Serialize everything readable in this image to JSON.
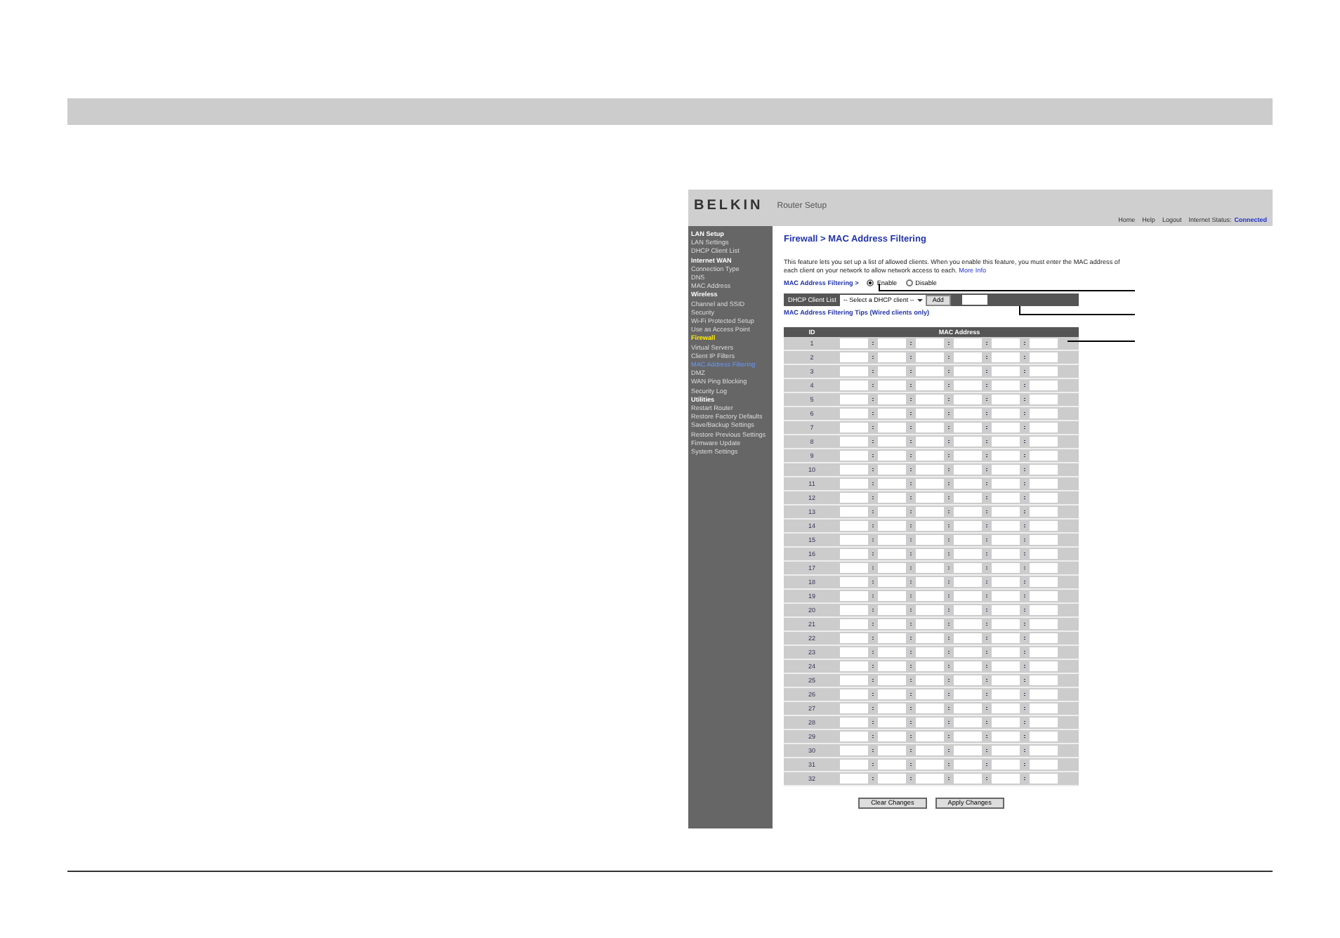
{
  "router": {
    "logo": "BELKIN",
    "title": "Router Setup",
    "nav": [
      "Home",
      "Help",
      "Logout"
    ],
    "status_label": "Internet Status:",
    "status_value": "Connected"
  },
  "sidebar": {
    "items": [
      {
        "kind": "heading",
        "label": "LAN Setup",
        "selected": false
      },
      {
        "kind": "link",
        "label": "LAN Settings",
        "selected": false
      },
      {
        "kind": "link",
        "label": "DHCP Client List",
        "selected": false
      },
      {
        "kind": "heading",
        "label": "Internet WAN",
        "selected": false
      },
      {
        "kind": "link",
        "label": "Connection Type",
        "selected": false
      },
      {
        "kind": "link",
        "label": "DNS",
        "selected": false
      },
      {
        "kind": "link",
        "label": "MAC Address",
        "selected": false
      },
      {
        "kind": "heading",
        "label": "Wireless",
        "selected": false
      },
      {
        "kind": "link",
        "label": "Channel and SSID",
        "selected": false
      },
      {
        "kind": "link",
        "label": "Security",
        "selected": false
      },
      {
        "kind": "link",
        "label": "Wi-Fi Protected Setup",
        "selected": false
      },
      {
        "kind": "link",
        "label": "Use as Access Point",
        "selected": false
      },
      {
        "kind": "heading",
        "label": "Firewall",
        "selected": true
      },
      {
        "kind": "link",
        "label": "Virtual Servers",
        "selected": false
      },
      {
        "kind": "link",
        "label": "Client IP Filters",
        "selected": false
      },
      {
        "kind": "link",
        "label": "MAC Address Filtering",
        "selected": true
      },
      {
        "kind": "link",
        "label": "DMZ",
        "selected": false
      },
      {
        "kind": "link",
        "label": "WAN Ping Blocking",
        "selected": false
      },
      {
        "kind": "link",
        "label": "Security Log",
        "selected": false
      },
      {
        "kind": "heading",
        "label": "Utilities",
        "selected": false
      },
      {
        "kind": "link",
        "label": "Restart Router",
        "selected": false
      },
      {
        "kind": "link",
        "label": "Restore Factory Defaults",
        "selected": false
      },
      {
        "kind": "link",
        "label": "Save/Backup Settings",
        "selected": false
      },
      {
        "kind": "link",
        "label": "Restore Previous Settings",
        "selected": false
      },
      {
        "kind": "link",
        "label": "Firmware Update",
        "selected": false
      },
      {
        "kind": "link",
        "label": "System Settings",
        "selected": false
      }
    ]
  },
  "content": {
    "breadcrumb": "Firewall > MAC Address Filtering",
    "description": "This feature lets you set up a list of allowed clients. When you enable this feature, you must enter the MAC address of each client on your network to allow network access to each.",
    "more_info": "More Info",
    "filter": {
      "label": "MAC Address Filtering >",
      "options": [
        {
          "label": "Enable",
          "selected": true
        },
        {
          "label": "Disable",
          "selected": false
        }
      ]
    },
    "dhcp": {
      "label": "DHCP Client List",
      "select": "-- Select a DHCP client --",
      "button": "Add"
    },
    "tips_link": "MAC Address Filtering Tips (Wired clients only)",
    "table": {
      "columns": [
        "ID",
        "MAC Address"
      ],
      "rows": [
        "1",
        "2",
        "3",
        "4",
        "5",
        "6",
        "7",
        "8",
        "9",
        "10",
        "11",
        "12",
        "13",
        "14",
        "15",
        "16",
        "17",
        "18",
        "19",
        "20",
        "21",
        "22",
        "23",
        "24",
        "25",
        "26",
        "27",
        "28",
        "29",
        "30",
        "31",
        "32"
      ]
    },
    "buttons": [
      "Clear Changes",
      "Apply Changes"
    ]
  }
}
